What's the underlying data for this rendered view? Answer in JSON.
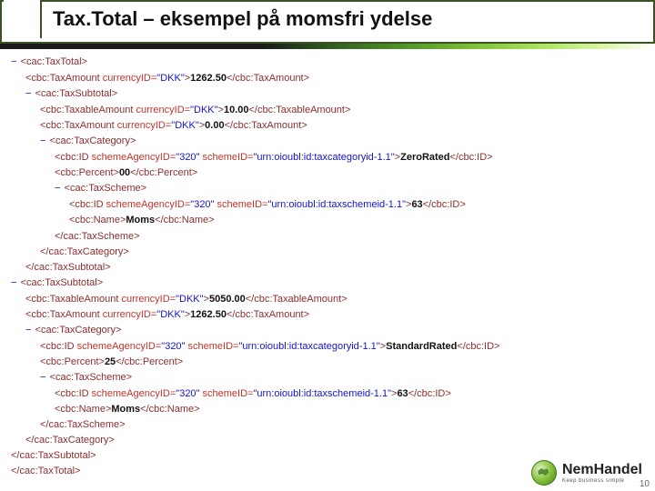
{
  "title": "Tax.Total – eksempel på momsfri ydelse",
  "footer": {
    "brand": "NemHandel",
    "sub": "Keep business simple",
    "page": "10"
  },
  "xml": {
    "root_open": "<cac:TaxTotal>",
    "taxAmount": {
      "tag_open": "<cbc:TaxAmount ",
      "attr": "currencyID=",
      "val": "\"DKK\"",
      "gt": ">",
      "text": "1262.50",
      "tag_close": "</cbc:TaxAmount>"
    },
    "sub1": {
      "open": "<cac:TaxSubtotal>",
      "taxable": {
        "tag_open": "<cbc:TaxableAmount ",
        "attr": "currencyID=",
        "val": "\"DKK\"",
        "gt": ">",
        "text": "10.00",
        "tag_close": "</cbc:TaxableAmount>"
      },
      "amount": {
        "tag_open": "<cbc:TaxAmount ",
        "attr": "currencyID=",
        "val": "\"DKK\"",
        "gt": ">",
        "text": "0.00",
        "tag_close": "</cbc:TaxAmount>"
      },
      "cat": {
        "open": "<cac:TaxCategory>",
        "id": {
          "tag_open": "<cbc:ID ",
          "a1": "schemeAgencyID=",
          "v1": "\"320\"",
          "sp": " ",
          "a2": "schemeID=",
          "v2": "\"urn:oioubl:id:taxcategoryid-1.1\"",
          "gt": ">",
          "text": "ZeroRated",
          "tag_close": "</cbc:ID>"
        },
        "percent": {
          "tag_open": "<cbc:Percent>",
          "text": "00",
          "tag_close": "</cbc:Percent>"
        },
        "scheme": {
          "open": "<cac:TaxScheme>",
          "id": {
            "tag_open": "<cbc:ID ",
            "a1": "schemeAgencyID=",
            "v1": "\"320\"",
            "sp": " ",
            "a2": "schemeID=",
            "v2": "\"urn:oioubl:id:taxschemeid-1.1\"",
            "gt": ">",
            "text": "63",
            "tag_close": "</cbc:ID>"
          },
          "name": {
            "tag_open": "<cbc:Name>",
            "text": "Moms",
            "tag_close": "</cbc:Name>"
          },
          "close": "</cac:TaxScheme>"
        },
        "close": "</cac:TaxCategory>"
      },
      "close": "</cac:TaxSubtotal>"
    },
    "sub2": {
      "open": "<cac:TaxSubtotal>",
      "taxable": {
        "tag_open": "<cbc:TaxableAmount ",
        "attr": "currencyID=",
        "val": "\"DKK\"",
        "gt": ">",
        "text": "5050.00",
        "tag_close": "</cbc:TaxableAmount>"
      },
      "amount": {
        "tag_open": "<cbc:TaxAmount ",
        "attr": "currencyID=",
        "val": "\"DKK\"",
        "gt": ">",
        "text": "1262.50",
        "tag_close": "</cbc:TaxAmount>"
      },
      "cat": {
        "open": "<cac:TaxCategory>",
        "id": {
          "tag_open": "<cbc:ID ",
          "a1": "schemeAgencyID=",
          "v1": "\"320\"",
          "sp": " ",
          "a2": "schemeID=",
          "v2": "\"urn:oioubl:id:taxcategoryid-1.1\"",
          "gt": ">",
          "text": "StandardRated",
          "tag_close": "</cbc:ID>"
        },
        "percent": {
          "tag_open": "<cbc:Percent>",
          "text": "25",
          "tag_close": "</cbc:Percent>"
        },
        "scheme": {
          "open": "<cac:TaxScheme>",
          "id": {
            "tag_open": "<cbc:ID ",
            "a1": "schemeAgencyID=",
            "v1": "\"320\"",
            "sp": " ",
            "a2": "schemeID=",
            "v2": "\"urn:oioubl:id:taxschemeid-1.1\"",
            "gt": ">",
            "text": "63",
            "tag_close": "</cbc:ID>"
          },
          "name": {
            "tag_open": "<cbc:Name>",
            "text": "Moms",
            "tag_close": "</cbc:Name>"
          },
          "close": "</cac:TaxScheme>"
        },
        "close": "</cac:TaxCategory>"
      },
      "close": "</cac:TaxSubtotal>"
    },
    "root_close": "</cac:TaxTotal>"
  }
}
